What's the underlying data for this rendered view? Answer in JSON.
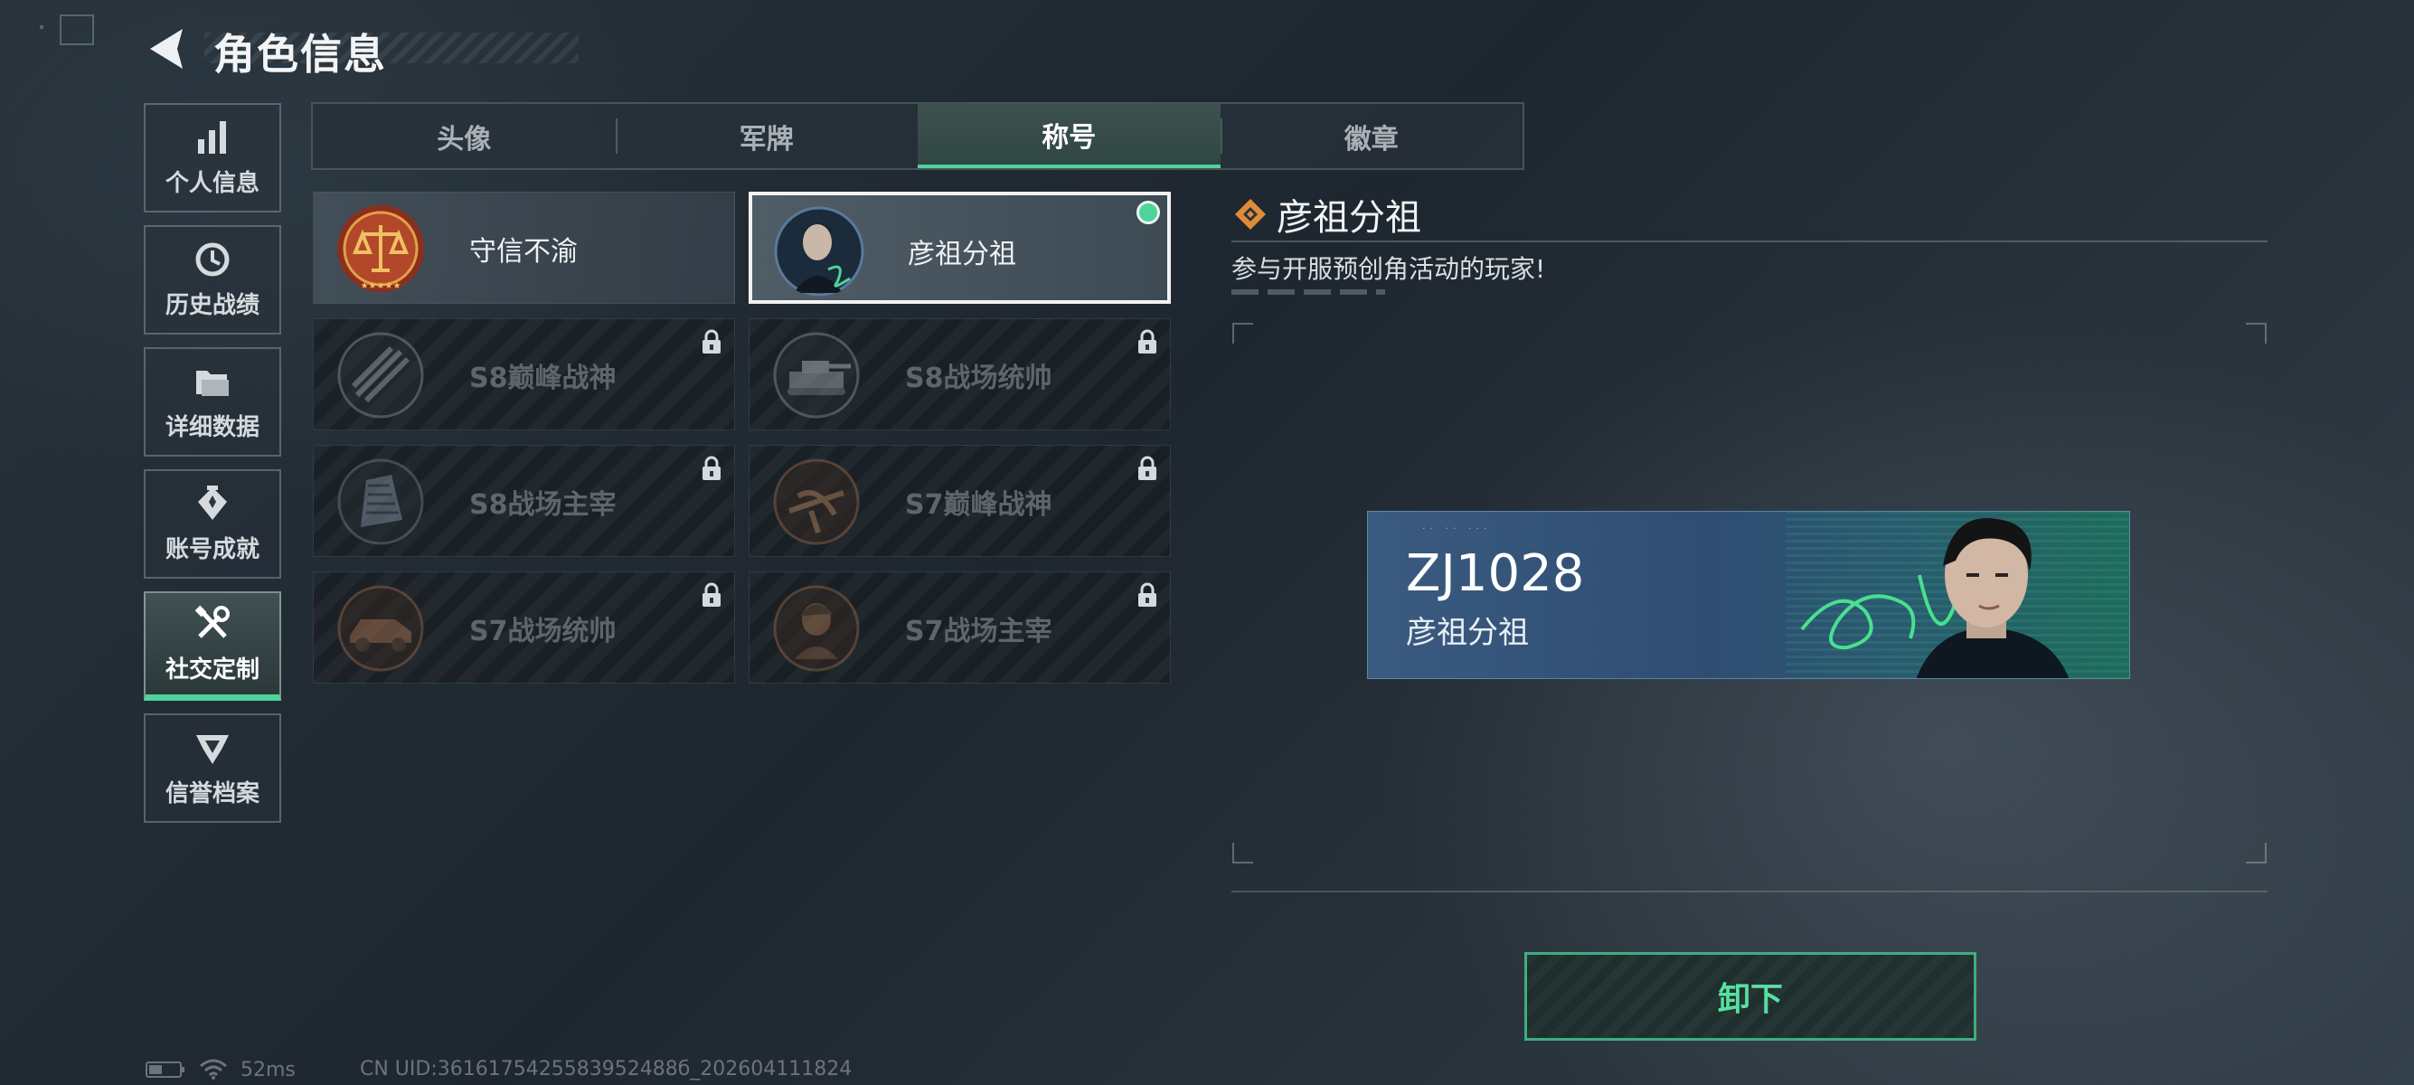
{
  "header": {
    "title": "角色信息"
  },
  "nav": {
    "items": [
      {
        "label": "个人信息",
        "icon": "bar-chart-icon",
        "active": false
      },
      {
        "label": "历史战绩",
        "icon": "history-clock-icon",
        "active": false
      },
      {
        "label": "详细数据",
        "icon": "folder-icon",
        "active": false
      },
      {
        "label": "账号成就",
        "icon": "achievement-icon",
        "active": false
      },
      {
        "label": "社交定制",
        "icon": "tools-icon",
        "active": true
      },
      {
        "label": "信誉档案",
        "icon": "credit-shield-icon",
        "active": false
      }
    ]
  },
  "tabs": [
    {
      "label": "头像",
      "active": false
    },
    {
      "label": "军牌",
      "active": false
    },
    {
      "label": "称号",
      "active": true
    },
    {
      "label": "徽章",
      "active": false
    }
  ],
  "titles": [
    {
      "label": "守信不渝",
      "emblem": "scales-medal-icon",
      "locked": false,
      "selected": false
    },
    {
      "label": "彦祖分祖",
      "emblem": "portrait-emblem-icon",
      "locked": false,
      "selected": true
    },
    {
      "label": "S8巅峰战神",
      "emblem": "rifles-medal-icon",
      "locked": true,
      "selected": false
    },
    {
      "label": "S8战场统帅",
      "emblem": "tank-medal-icon",
      "locked": true,
      "selected": false
    },
    {
      "label": "S8战场主宰",
      "emblem": "building-medal-icon",
      "locked": true,
      "selected": false
    },
    {
      "label": "S7巅峰战神",
      "emblem": "crossbow-medal-icon",
      "locked": true,
      "selected": false
    },
    {
      "label": "S7战场统帅",
      "emblem": "vehicle-medal-icon",
      "locked": true,
      "selected": false
    },
    {
      "label": "S7战场主宰",
      "emblem": "soldier-medal-icon",
      "locked": true,
      "selected": false
    }
  ],
  "detail": {
    "title": "彦祖分祖",
    "description": "参与开服预创角活动的玩家!",
    "nameplate": {
      "player_id": "ZJ1028",
      "title": "彦祖分祖"
    },
    "unequip_label": "卸下"
  },
  "status": {
    "ping": "52ms",
    "uid": "CN UID:3616175425583952488б_202604111824"
  },
  "colors": {
    "accent_green": "#4fd39a",
    "detail_diamond": "#e08a3a"
  }
}
